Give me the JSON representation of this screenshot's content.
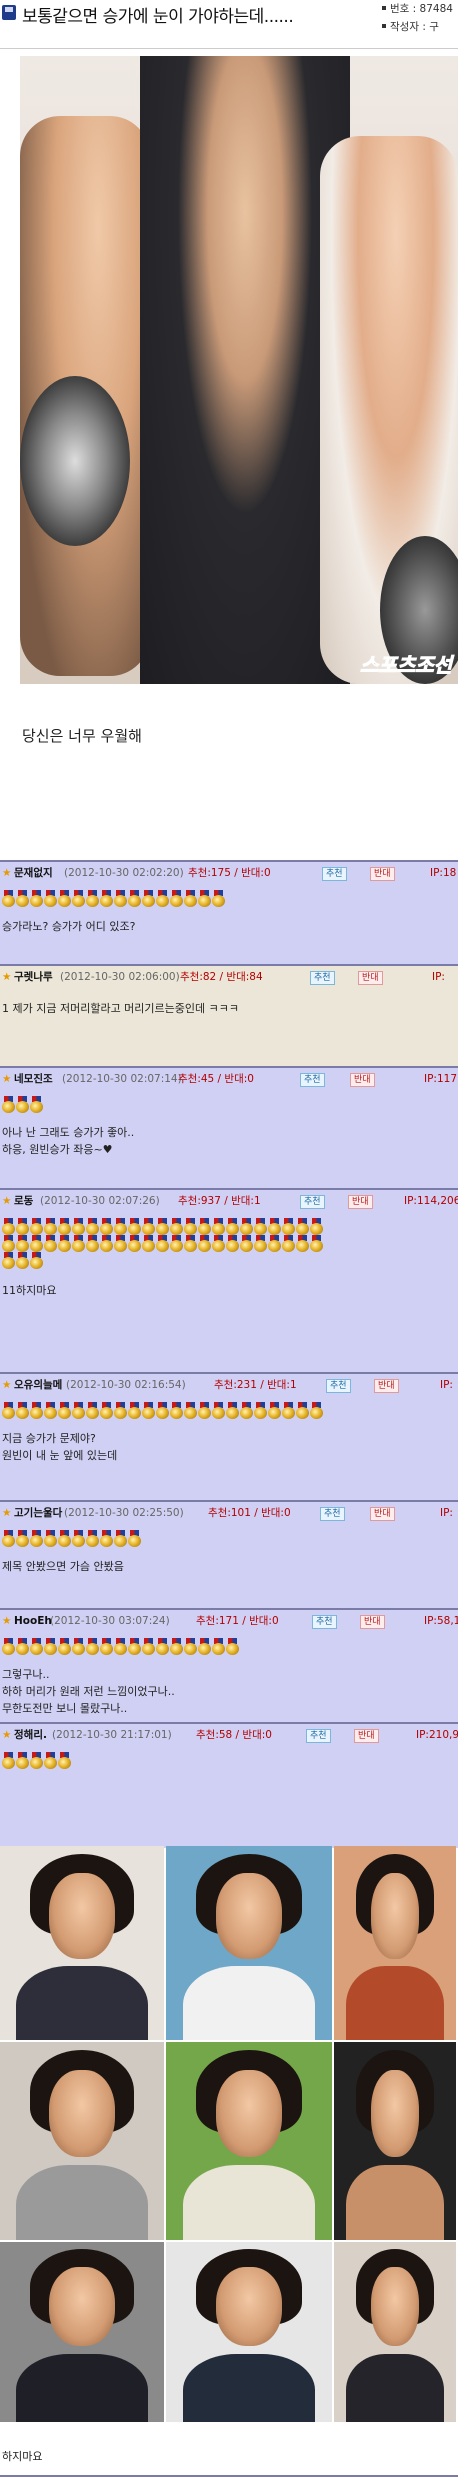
{
  "post": {
    "title": "보통같으면 승가에 눈이 가야하는데......",
    "number_label": "번호 : 87484",
    "author_label": "작성자 : 구",
    "caption": "당신은 너무 우월해",
    "watermark": "스포츠조선"
  },
  "comments": [
    {
      "nick": "문재없지",
      "date": "(2012-10-30 02:02:20)",
      "votes": "추천:175 / 반대:0",
      "up": "추천",
      "down": "반대",
      "ip": "IP:18",
      "medals": 16,
      "lines": [
        "승가라노? 승가가 어디 있조?"
      ],
      "bg": "#d0d0f4"
    },
    {
      "nick": "구렛나루",
      "date": "(2012-10-30 02:06:00)",
      "votes": "추천:82 / 반대:84",
      "up": "추천",
      "down": "반대",
      "ip": "IP:",
      "medals": 0,
      "lines": [
        "1 제가 지금 저머리할라고 머리기르는중인데 ㅋㅋㅋ"
      ],
      "bg": "#ece6d8"
    },
    {
      "nick": "네모진조",
      "date": "(2012-10-30 02:07:14)",
      "votes": "추천:45 / 반대:0",
      "up": "추천",
      "down": "반대",
      "ip": "IP:117",
      "medals": 3,
      "lines": [
        "아나 난 그래도 승가가 좋아..",
        "하응, 원빈승가 좌응~♥"
      ],
      "bg": "#d0d0f4"
    },
    {
      "nick": "로동",
      "date": "(2012-10-30 02:07:26)",
      "votes": "추천:937 / 반대:1",
      "up": "추천",
      "down": "반대",
      "ip": "IP:114,206",
      "medals": 49,
      "lines": [
        "11하지마요"
      ],
      "bg": "#d0d0f4"
    },
    {
      "nick": "오유의늘메",
      "date": "(2012-10-30 02:16:54)",
      "votes": "추천:231 / 반대:1",
      "up": "추천",
      "down": "반대",
      "ip": "IP:",
      "medals": 23,
      "lines": [
        "지금 승가가 문제야?",
        "원빈이 내 눈 앞에 있는데"
      ],
      "bg": "#d0d0f4"
    },
    {
      "nick": "고기는울다",
      "date": "(2012-10-30 02:25:50)",
      "votes": "추천:101 / 반대:0",
      "up": "추천",
      "down": "반대",
      "ip": "IP:",
      "medals": 10,
      "lines": [
        "제목 안봤으면 가슴 안봤음"
      ],
      "bg": "#d0d0f4"
    },
    {
      "nick": "HooEh",
      "date": "(2012-10-30 03:07:24)",
      "votes": "추천:171 / 반대:0",
      "up": "추천",
      "down": "반대",
      "ip": "IP:58,1",
      "medals": 17,
      "lines": [
        "그렇구나..",
        "하하 머리가 원래 저런 느낌이었구나..",
        "무한도전만 보니 몰랐구나.."
      ],
      "bg": "#d0d0f4"
    },
    {
      "nick": "정해리.",
      "date": "(2012-10-30 21:17:01)",
      "votes": "추천:58 / 반대:0",
      "up": "추천",
      "down": "반대",
      "ip": "IP:210,9",
      "medals": 5,
      "lines": [],
      "bg": "#d0d0f4"
    }
  ],
  "last_comment_text": "하지마요"
}
